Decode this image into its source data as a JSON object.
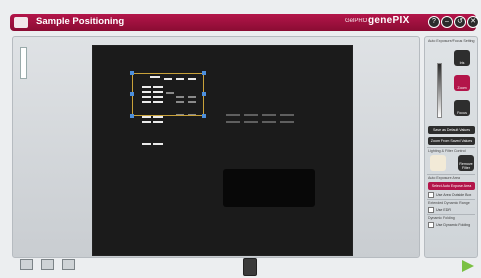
{
  "window": {
    "title": "Sample Positioning",
    "brand_small": "GelPRO",
    "brand": "genePIX",
    "buttons": [
      "?",
      "–",
      "↺",
      "✕"
    ]
  },
  "panel": {
    "camera_section_label": "Auto Exposure/Focus Setting",
    "iris_label": "Iris",
    "zoom_label": "Zoom",
    "focus_label": "Focus",
    "save_default_label": "Save as Default Values",
    "zoom_saved_label": "Zoom From Saved Values",
    "lighting_label": "Lighting & Filter Control",
    "light_label": "",
    "filter_label": "Remove Filter",
    "auto_exposure_section": "Auto Exposure Area",
    "select_area_label": "Select Auto Expose Area",
    "use_area_outside_label": "Use Area Outside Box",
    "ext_dynamic_label": "Extended Dynamic Range",
    "use_edr_label": "Use EDR",
    "dynamic_folding_section": "Dynamic Folding",
    "use_dynamic_label": "Use Dynamic Folding"
  },
  "colors": {
    "titlebar": "#9c0f3d",
    "accent_button": "#b3154a",
    "image_bg": "#1b1b1b",
    "selection": "#c9a23a",
    "handle": "#4d8fdc",
    "ok_arrow": "#7ac142"
  },
  "icons": {
    "app": "app-icon",
    "help": "help-icon",
    "minimize": "minimize-icon",
    "refresh": "refresh-icon",
    "close": "close-icon",
    "home": "home-icon",
    "ok": "arrow-right-icon"
  }
}
